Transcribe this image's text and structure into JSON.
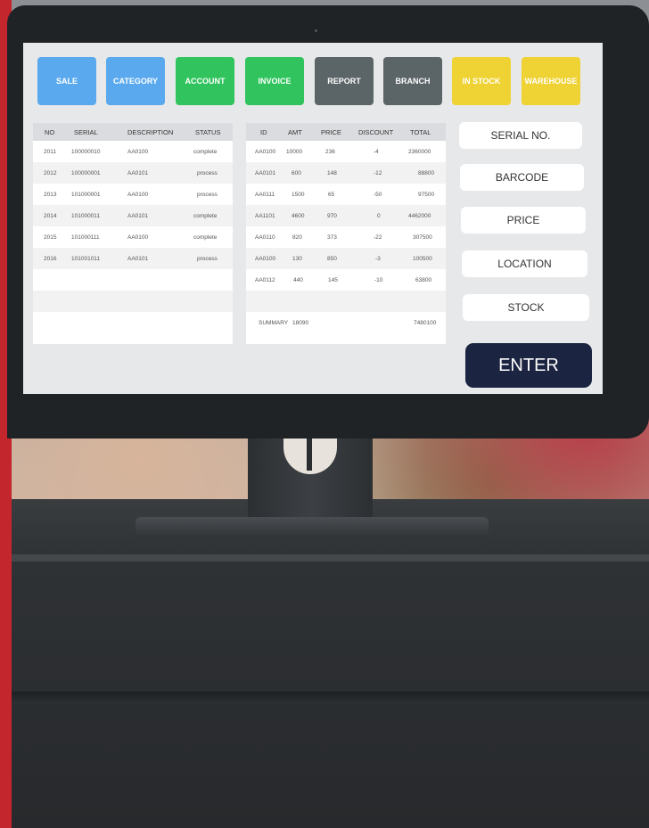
{
  "colors": {
    "sale": "#5aa9ee",
    "category": "#5aa9ee",
    "account": "#31c45e",
    "invoice": "#31c45e",
    "report": "#5b6568",
    "branch": "#5b6568",
    "in_stock": "#efd233",
    "warehouse": "#efd233",
    "enter": "#1b2440"
  },
  "nav": [
    {
      "label": "SALE",
      "color": "#5aa9ee"
    },
    {
      "label": "CATEGORY",
      "color": "#5aa9ee"
    },
    {
      "label": "ACCOUNT",
      "color": "#31c45e"
    },
    {
      "label": "INVOICE",
      "color": "#31c45e"
    },
    {
      "label": "REPORT",
      "color": "#5b6568"
    },
    {
      "label": "BRANCH",
      "color": "#5b6568"
    },
    {
      "label": "IN STOCK",
      "color": "#efd233"
    },
    {
      "label": "WAREHOUSE",
      "color": "#efd233"
    }
  ],
  "orders_table": {
    "headers": {
      "no": "NO",
      "serial": "SERIAL",
      "description": "DESCRIPTION",
      "status": "STATUS"
    },
    "rows": [
      {
        "no": "2011",
        "serial": "100000010",
        "description": "AA0100",
        "status": "complete"
      },
      {
        "no": "2012",
        "serial": "100000001",
        "description": "AA0101",
        "status": "process"
      },
      {
        "no": "2013",
        "serial": "101000001",
        "description": "AA0100",
        "status": "process"
      },
      {
        "no": "2014",
        "serial": "101000011",
        "description": "AA0101",
        "status": "complete"
      },
      {
        "no": "2015",
        "serial": "101000111",
        "description": "AA0100",
        "status": "complete"
      },
      {
        "no": "2016",
        "serial": "101001011",
        "description": "AA0101",
        "status": "process"
      }
    ]
  },
  "items_table": {
    "headers": {
      "id": "ID",
      "amt": "AMT",
      "price": "PRICE",
      "discount": "DISCOUNT",
      "total": "TOTAL"
    },
    "rows": [
      {
        "id": "AA0100",
        "amt": "10000",
        "price": "236",
        "discount": "-4",
        "total": "2360000"
      },
      {
        "id": "AA0101",
        "amt": "600",
        "price": "148",
        "discount": "-12",
        "total": "88800"
      },
      {
        "id": "AA0111",
        "amt": "1500",
        "price": "65",
        "discount": "-50",
        "total": "97500"
      },
      {
        "id": "AA1101",
        "amt": "4600",
        "price": "970",
        "discount": "0",
        "total": "4462000"
      },
      {
        "id": "AA0110",
        "amt": "820",
        "price": "373",
        "discount": "-22",
        "total": "307500"
      },
      {
        "id": "AA0100",
        "amt": "130",
        "price": "850",
        "discount": "-3",
        "total": "100500"
      },
      {
        "id": "AA0112",
        "amt": "440",
        "price": "145",
        "discount": "-10",
        "total": "63800"
      }
    ],
    "summary": {
      "label": "SUMMARY",
      "amt": "18090",
      "total": "7480100"
    }
  },
  "fields": {
    "serial_no": "SERIAL NO.",
    "barcode": "BARCODE",
    "price": "PRICE",
    "location": "LOCATION",
    "stock": "STOCK"
  },
  "enter_label": "ENTER"
}
